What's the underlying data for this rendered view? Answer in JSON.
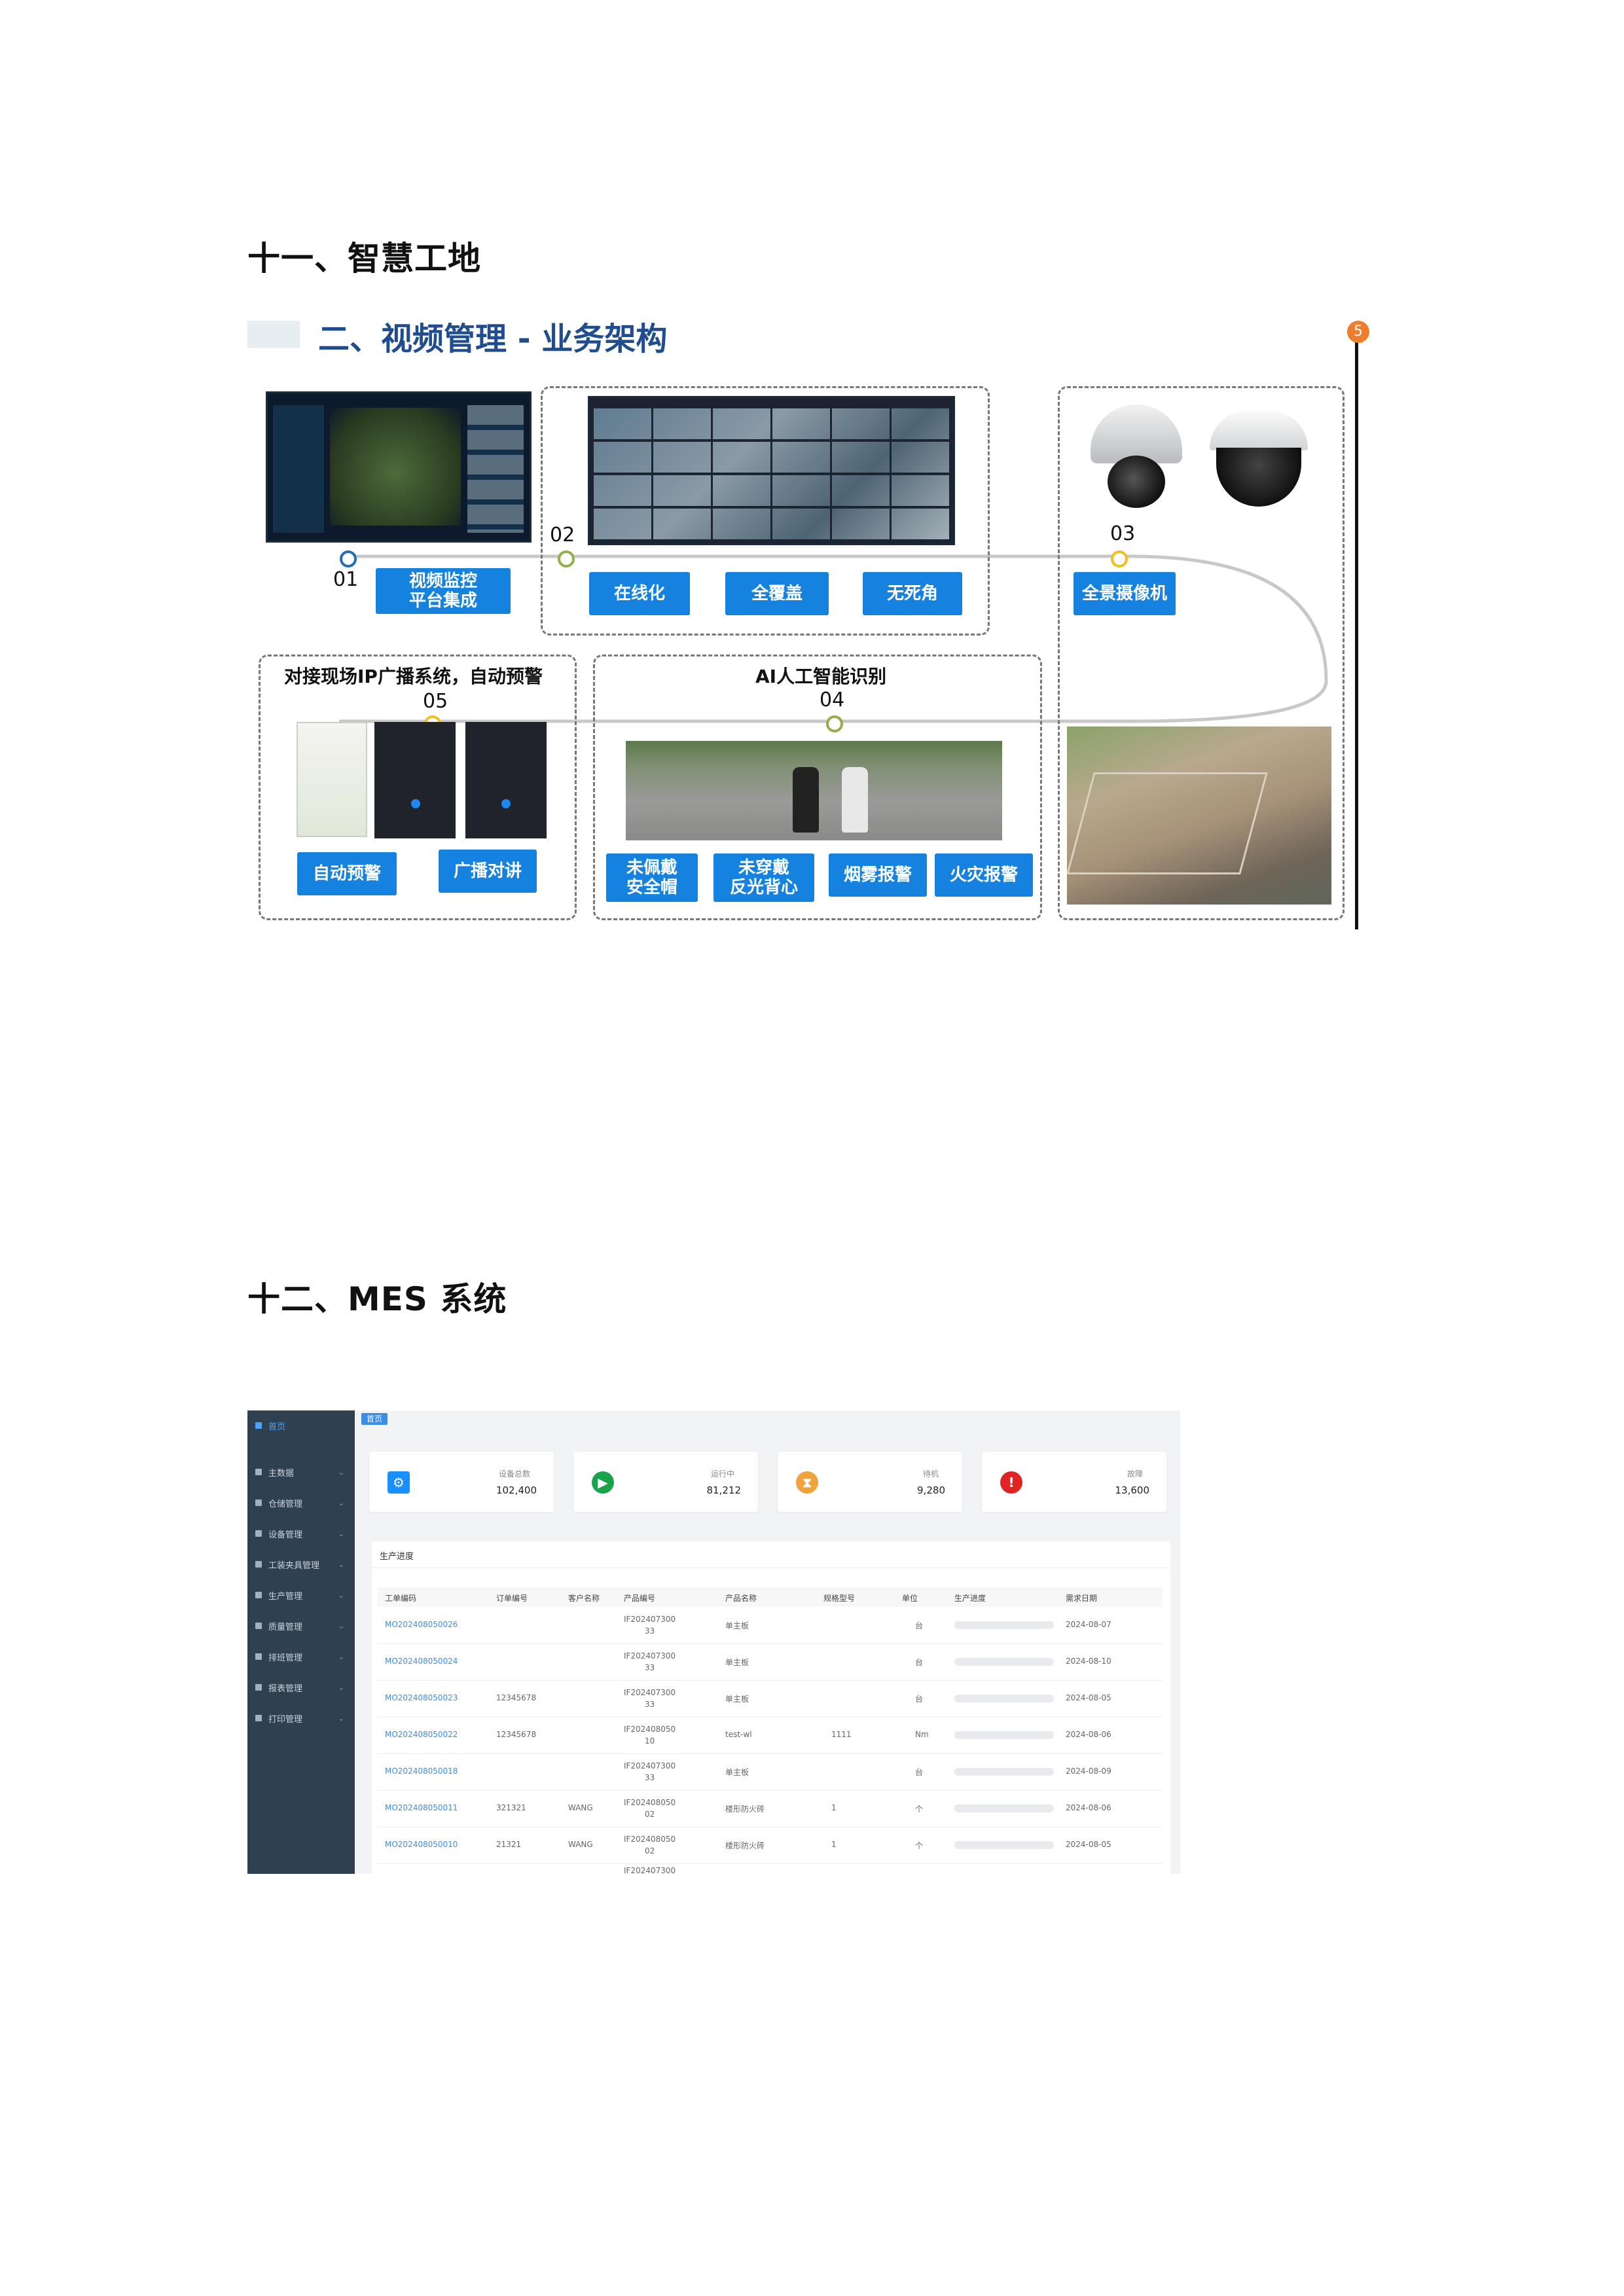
{
  "sections": {
    "smart_site_heading": "十一、智慧工地",
    "mes_heading": "十二、MES 系统"
  },
  "figure1": {
    "title": "二、视频管理 - 业务架构",
    "corner_badge": "5",
    "step01": {
      "num": "01",
      "button": "视频监控\n平台集成"
    },
    "step02": {
      "num": "02",
      "buttons": [
        "在线化",
        "全覆盖",
        "无死角"
      ]
    },
    "step03": {
      "num": "03",
      "button": "全景摄像机"
    },
    "step04": {
      "num": "04",
      "caption": "AI人工智能识别",
      "buttons": [
        "未佩戴\n安全帽",
        "未穿戴\n反光背心",
        "烟雾报警",
        "火灾报警"
      ]
    },
    "step05": {
      "num": "05",
      "caption": "对接现场IP广播系统，自动预警",
      "buttons": [
        "自动预警",
        "广播对讲"
      ]
    }
  },
  "mes": {
    "tab": "首页",
    "sidebar": [
      {
        "label": "首页",
        "icon": "home-icon",
        "active": true
      },
      {
        "label": "主数据",
        "icon": "grid-icon"
      },
      {
        "label": "仓储管理",
        "icon": "warehouse-icon"
      },
      {
        "label": "设备管理",
        "icon": "device-icon"
      },
      {
        "label": "工装夹具管理",
        "icon": "tool-icon"
      },
      {
        "label": "生产管理",
        "icon": "factory-icon"
      },
      {
        "label": "质量管理",
        "icon": "quality-icon"
      },
      {
        "label": "排班管理",
        "icon": "user-icon"
      },
      {
        "label": "报表管理",
        "icon": "report-icon"
      },
      {
        "label": "打印管理",
        "icon": "print-icon"
      }
    ],
    "stats": [
      {
        "label": "设备总数",
        "value": "102,400",
        "color": "#1890ff",
        "icon": "gear-icon"
      },
      {
        "label": "运行中",
        "value": "81,212",
        "color": "#19a34a",
        "icon": "play-icon"
      },
      {
        "label": "待机",
        "value": "9,280",
        "color": "#f0a23b",
        "icon": "hourglass-icon"
      },
      {
        "label": "故障",
        "value": "13,600",
        "color": "#e02424",
        "icon": "alert-icon"
      }
    ],
    "panel_title": "生产进度",
    "columns": [
      "工单编码",
      "订单编号",
      "客户名称",
      "产品编号",
      "产品名称",
      "规格型号",
      "单位",
      "生产进度",
      "需求日期"
    ],
    "rows": [
      {
        "code": "MO202408050026",
        "order": "",
        "customer": "",
        "product_code": "IF202407300\n33",
        "product_name": "单主板",
        "spec": "",
        "unit": "台",
        "progress": 0,
        "date": "2024-08-07"
      },
      {
        "code": "MO202408050024",
        "order": "",
        "customer": "",
        "product_code": "IF202407300\n33",
        "product_name": "单主板",
        "spec": "",
        "unit": "台",
        "progress": 0,
        "date": "2024-08-10"
      },
      {
        "code": "MO202408050023",
        "order": "12345678",
        "customer": "",
        "product_code": "IF202407300\n33",
        "product_name": "单主板",
        "spec": "",
        "unit": "台",
        "progress": 0,
        "date": "2024-08-05"
      },
      {
        "code": "MO202408050022",
        "order": "12345678",
        "customer": "",
        "product_code": "IF202408050\n10",
        "product_name": "test-wl",
        "spec": "1111",
        "unit": "Nm",
        "progress": 0,
        "date": "2024-08-06"
      },
      {
        "code": "MO202408050018",
        "order": "",
        "customer": "",
        "product_code": "IF202407300\n33",
        "product_name": "单主板",
        "spec": "",
        "unit": "台",
        "progress": 0,
        "date": "2024-08-09"
      },
      {
        "code": "MO202408050011",
        "order": "321321",
        "customer": "WANG",
        "product_code": "IF202408050\n02",
        "product_name": "楼形防火砖",
        "spec": "1",
        "unit": "个",
        "progress": 0,
        "date": "2024-08-06"
      },
      {
        "code": "MO202408050010",
        "order": "21321",
        "customer": "WANG",
        "product_code": "IF202408050\n02",
        "product_name": "楼形防火砖",
        "spec": "1",
        "unit": "个",
        "progress": 0,
        "date": "2024-08-05"
      }
    ],
    "partial_row_code": "IF202407300"
  }
}
